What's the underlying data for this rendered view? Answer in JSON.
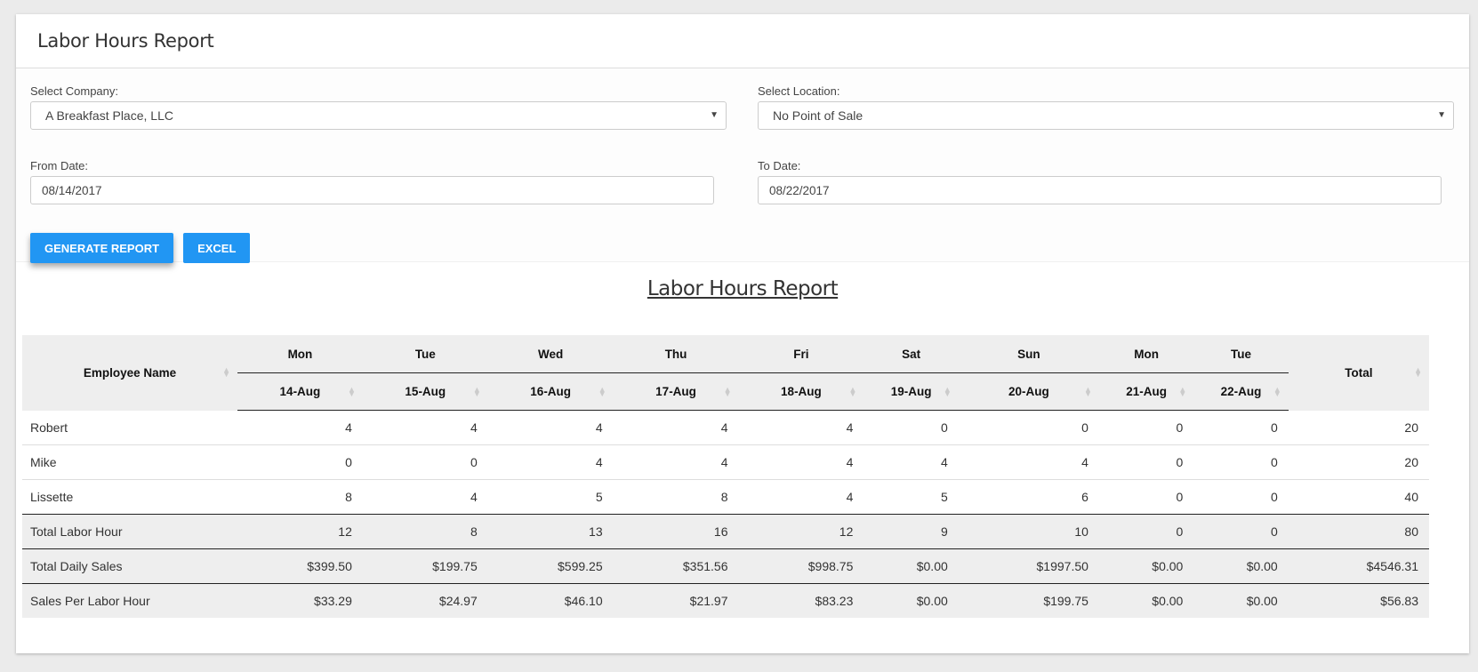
{
  "header": {
    "title": "Labor Hours Report"
  },
  "form": {
    "company_label": "Select Company:",
    "company_value": "A Breakfast Place, LLC",
    "location_label": "Select Location:",
    "location_value": "No Point of Sale",
    "from_label": "From Date:",
    "from_value": "08/14/2017",
    "to_label": "To Date:",
    "to_value": "08/22/2017",
    "generate_label": "Generate Report",
    "excel_label": "Excel"
  },
  "report": {
    "title": "Labor Hours Report",
    "employee_header": "Employee Name",
    "total_header": "Total",
    "days": [
      "Mon",
      "Tue",
      "Wed",
      "Thu",
      "Fri",
      "Sat",
      "Sun",
      "Mon",
      "Tue"
    ],
    "dates": [
      "14-Aug",
      "15-Aug",
      "16-Aug",
      "17-Aug",
      "18-Aug",
      "19-Aug",
      "20-Aug",
      "21-Aug",
      "22-Aug"
    ],
    "employees": [
      {
        "name": "Robert",
        "hours": [
          "4",
          "4",
          "4",
          "4",
          "4",
          "0",
          "0",
          "0",
          "0"
        ],
        "total": "20"
      },
      {
        "name": "Mike",
        "hours": [
          "0",
          "0",
          "4",
          "4",
          "4",
          "4",
          "4",
          "0",
          "0"
        ],
        "total": "20"
      },
      {
        "name": "Lissette",
        "hours": [
          "8",
          "4",
          "5",
          "8",
          "4",
          "5",
          "6",
          "0",
          "0"
        ],
        "total": "40"
      }
    ],
    "summary": [
      {
        "label": "Total Labor Hour",
        "values": [
          "12",
          "8",
          "13",
          "16",
          "12",
          "9",
          "10",
          "0",
          "0"
        ],
        "total": "80"
      },
      {
        "label": "Total Daily Sales",
        "values": [
          "$399.50",
          "$199.75",
          "$599.25",
          "$351.56",
          "$998.75",
          "$0.00",
          "$1997.50",
          "$0.00",
          "$0.00"
        ],
        "total": "$4546.31"
      },
      {
        "label": "Sales Per Labor Hour",
        "values": [
          "$33.29",
          "$24.97",
          "$46.10",
          "$21.97",
          "$83.23",
          "$0.00",
          "$199.75",
          "$0.00",
          "$0.00"
        ],
        "total": "$56.83"
      }
    ]
  }
}
